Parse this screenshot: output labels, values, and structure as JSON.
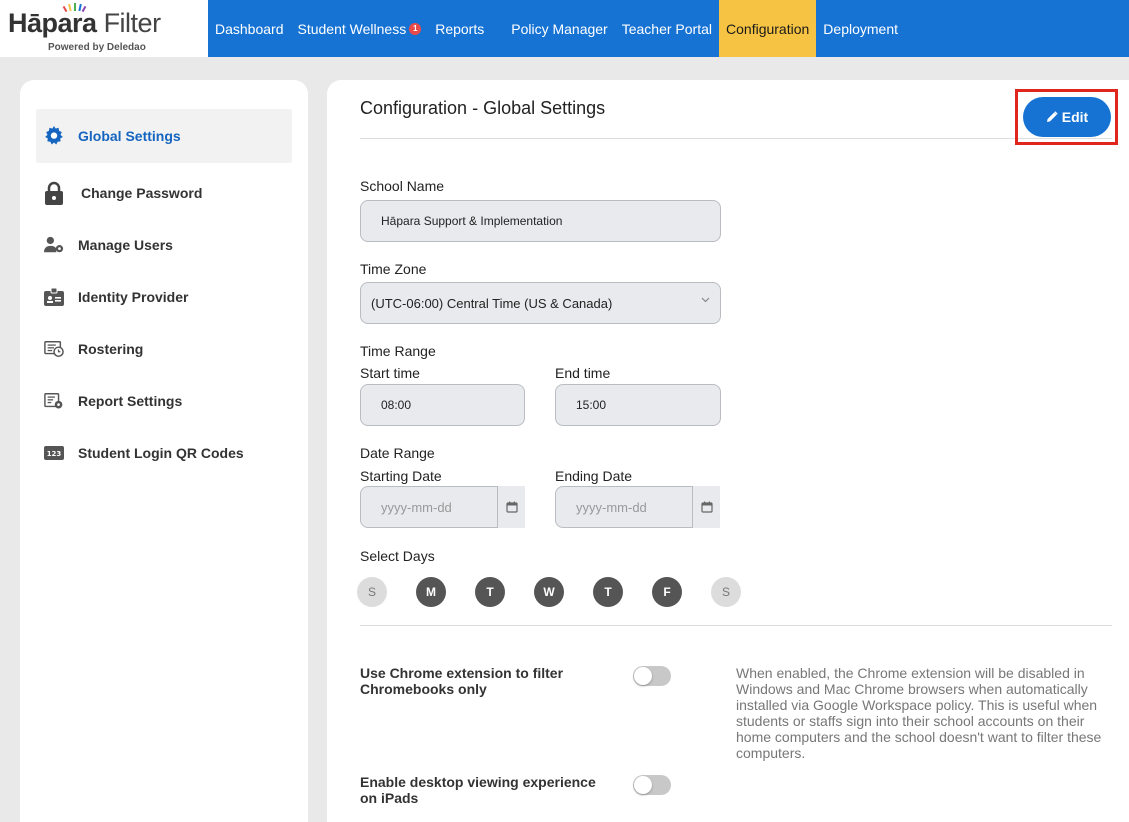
{
  "logo": {
    "brand_a": "Hāpara",
    "brand_b": "Filter",
    "tagline": "Powered by Deledao"
  },
  "nav": [
    {
      "label": "Dashboard",
      "badge": ""
    },
    {
      "label": "Student Wellness",
      "badge": "1"
    },
    {
      "label": "Reports",
      "badge": ""
    },
    {
      "label": "Policy Manager",
      "badge": ""
    },
    {
      "label": "Teacher Portal",
      "badge": ""
    },
    {
      "label": "Configuration",
      "badge": ""
    },
    {
      "label": "Deployment",
      "badge": ""
    }
  ],
  "sidebar": {
    "items": [
      {
        "label": "Global Settings",
        "icon": "gear-icon"
      },
      {
        "label": "Change Password",
        "icon": "lock-icon"
      },
      {
        "label": "Manage Users",
        "icon": "users-gear-icon"
      },
      {
        "label": "Identity Provider",
        "icon": "id-badge-icon"
      },
      {
        "label": "Rostering",
        "icon": "roster-clock-icon"
      },
      {
        "label": "Report Settings",
        "icon": "report-gear-icon"
      },
      {
        "label": "Student Login QR Codes",
        "icon": "numbers-icon"
      }
    ]
  },
  "main": {
    "title": "Configuration - Global Settings",
    "edit_label": "Edit",
    "school_name_label": "School Name",
    "school_name_value": "Hāpara Support & Implementation",
    "time_zone_label": "Time Zone",
    "time_zone_value": "(UTC-06:00) Central Time (US & Canada)",
    "time_range_label": "Time Range",
    "start_time_label": "Start time",
    "start_time_value": "08:00",
    "end_time_label": "End time",
    "end_time_value": "15:00",
    "date_range_label": "Date Range",
    "starting_date_label": "Starting Date",
    "starting_date_placeholder": "yyyy-mm-dd",
    "ending_date_label": "Ending Date",
    "ending_date_placeholder": "yyyy-mm-dd",
    "select_days_label": "Select Days",
    "days": [
      "S",
      "M",
      "T",
      "W",
      "T",
      "F",
      "S"
    ],
    "chrome_ext_label": "Use Chrome extension to filter Chromebooks only",
    "chrome_ext_desc": "When enabled, the Chrome extension will be disabled in Windows and Mac Chrome browsers when automatically installed via Google Workspace policy. This is useful when students or staffs sign into their school accounts on their home computers and the school doesn't want to filter these computers.",
    "ipad_label": "Enable desktop viewing experience on iPads"
  },
  "colors": {
    "nav_bg": "#1673d4",
    "nav_active": "#f6c343",
    "highlight": "#e0261c"
  }
}
